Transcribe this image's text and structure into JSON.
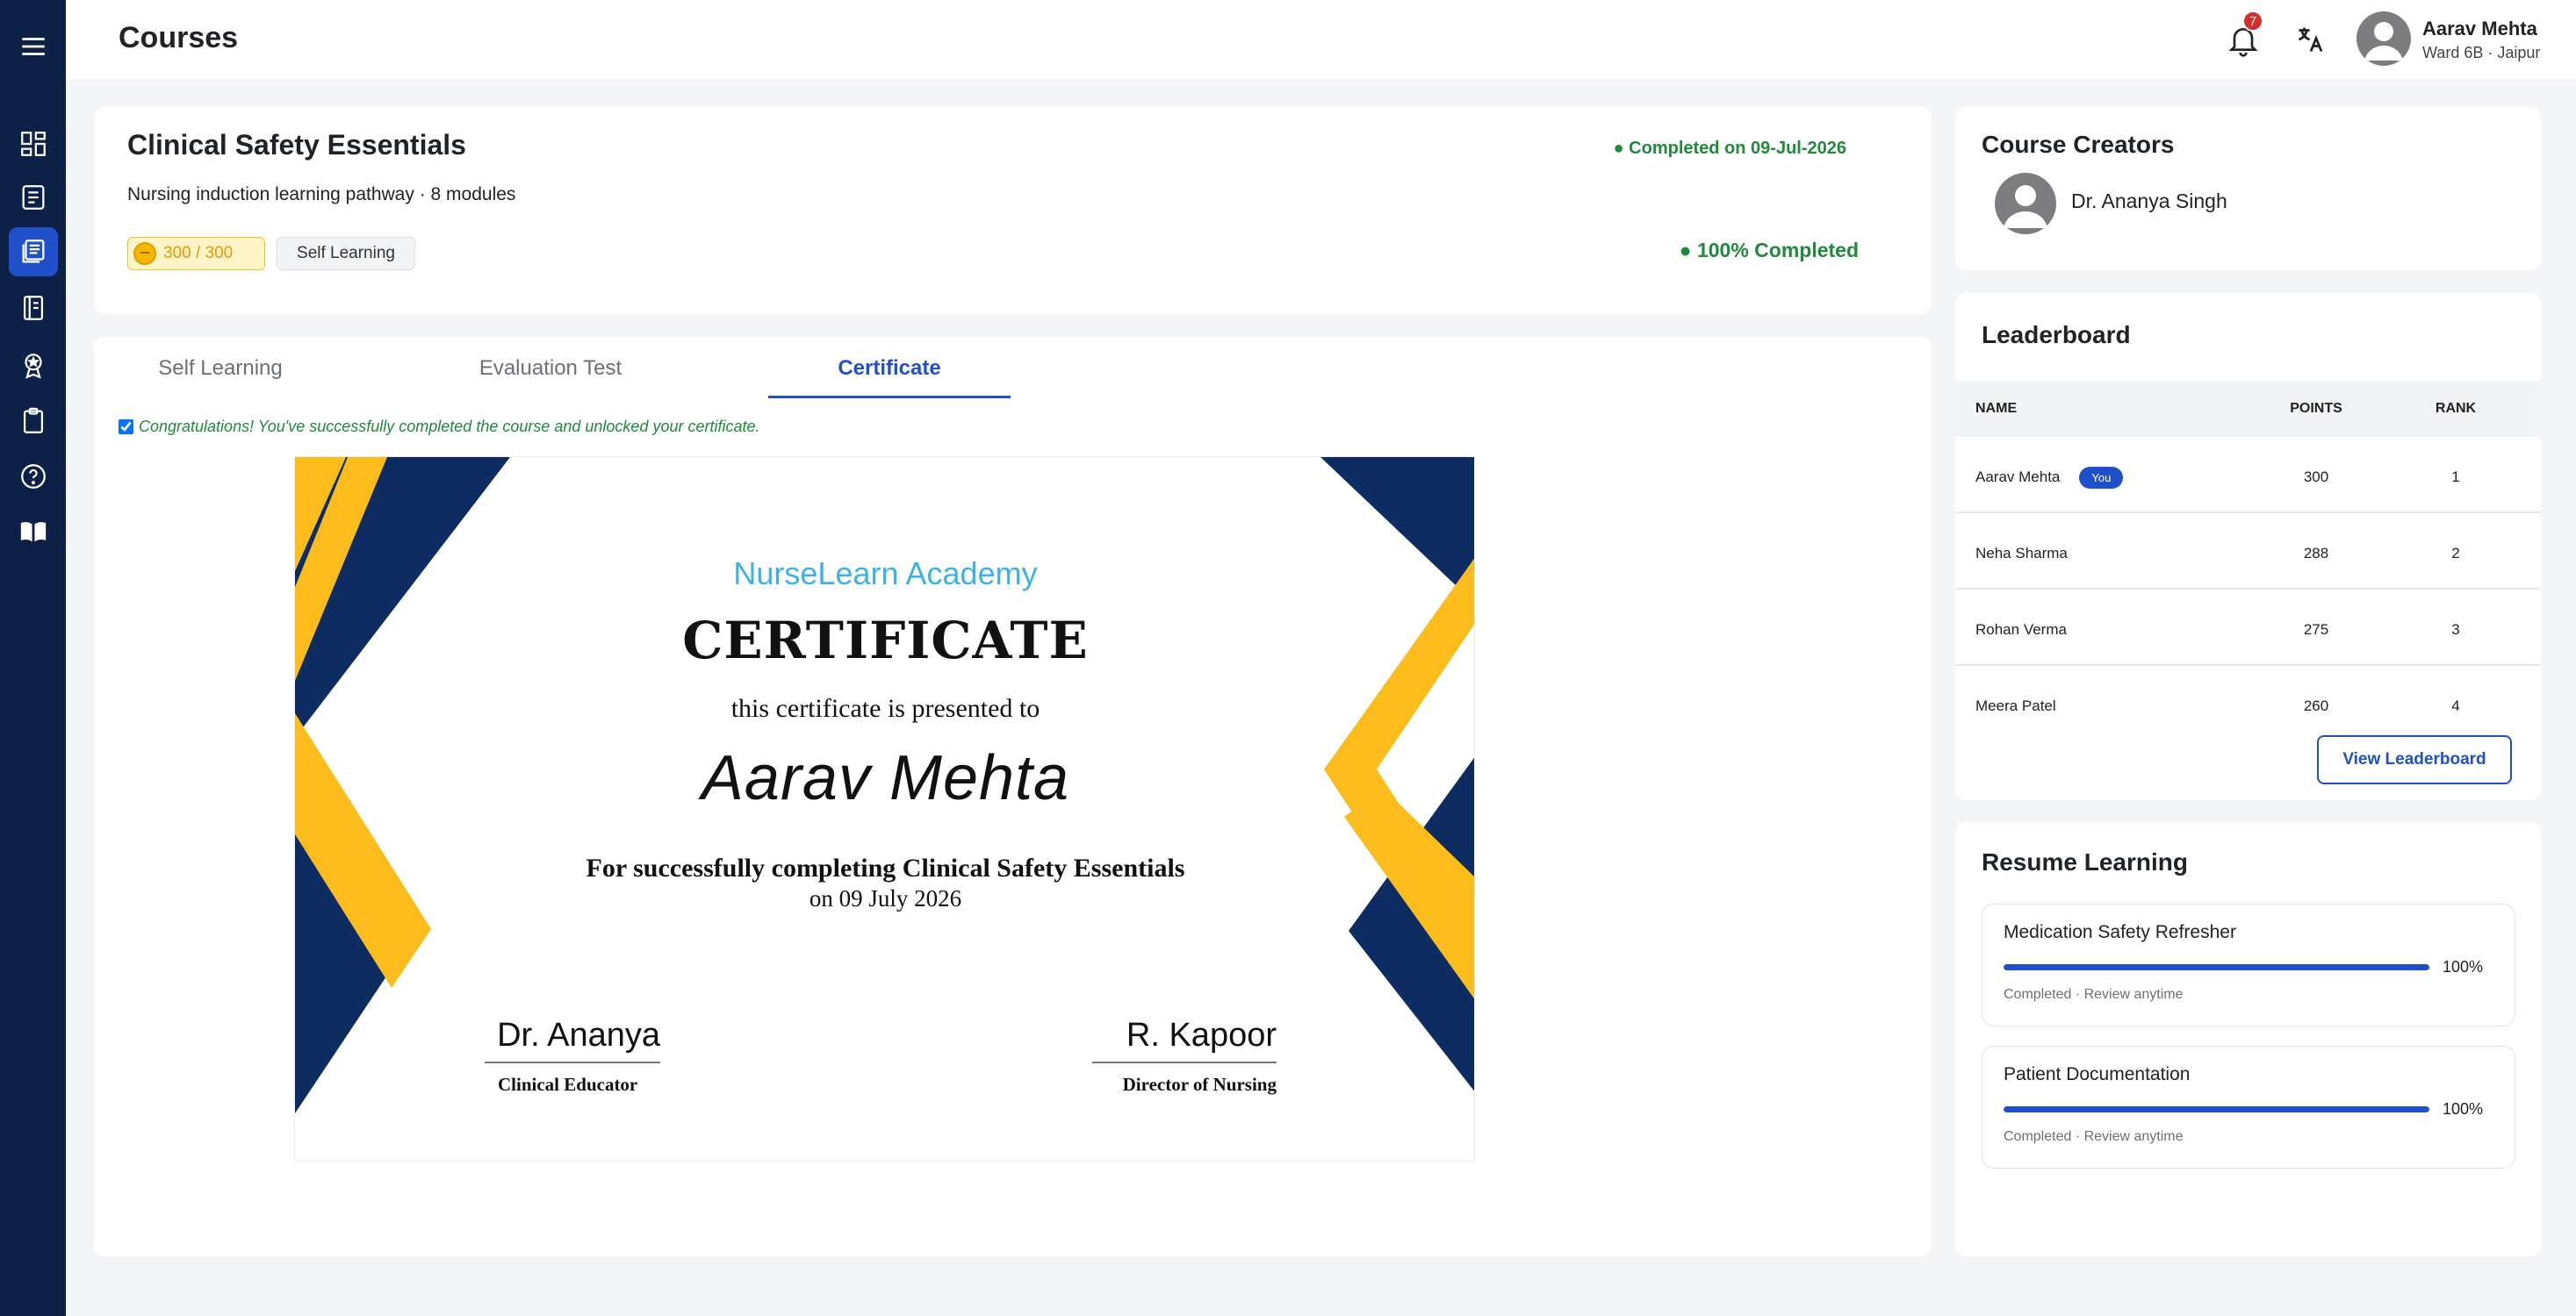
{
  "header": {
    "page_title": "Courses",
    "notification_count": "7",
    "user_name": "Aarav Mehta",
    "user_location": "Ward 6B · Jaipur"
  },
  "sidebar": {
    "items": [
      {
        "icon": "dashboard-icon"
      },
      {
        "icon": "notes-icon"
      },
      {
        "icon": "courses-icon",
        "active": true
      },
      {
        "icon": "journal-icon"
      },
      {
        "icon": "badge-icon"
      },
      {
        "icon": "clipboard-icon"
      },
      {
        "icon": "help-icon"
      },
      {
        "icon": "library-icon"
      }
    ]
  },
  "course": {
    "title": "Clinical Safety Essentials",
    "subtitle": "Nursing induction learning pathway · 8 modules",
    "points": "300 / 300",
    "type": "Self Learning",
    "completed_on": "● Completed on 09-Jul-2026",
    "progress_text": "● 100% Completed"
  },
  "tabs": [
    {
      "label": "Self Learning"
    },
    {
      "label": "Evaluation Test"
    },
    {
      "label": "Certificate",
      "active": true
    }
  ],
  "congrats": "Congratulations! You've successfully completed the course and unlocked your certificate.",
  "certificate": {
    "org": "NurseLearn Academy",
    "title": "CERTIFICATE",
    "presented_to": "this certificate is presented to",
    "recipient": "Aarav Mehta",
    "reason": "For successfully completing Clinical Safety Essentials",
    "date": "on 09 July 2026",
    "signatures": [
      {
        "name": "Dr. Ananya",
        "role": "Clinical Educator"
      },
      {
        "name": "R. Kapoor",
        "role": "Director of Nursing"
      }
    ],
    "colors": {
      "navy": "#0d2c61",
      "gold": "#fcbd1c"
    }
  },
  "creators": {
    "heading": "Course Creators",
    "items": [
      {
        "name": "Dr. Ananya Singh"
      }
    ]
  },
  "leaderboard": {
    "heading": "Leaderboard",
    "columns": [
      "NAME",
      "POINTS",
      "RANK"
    ],
    "you_label": "You",
    "rows": [
      {
        "name": "Aarav Mehta",
        "points": "300",
        "rank": "1",
        "is_you": true
      },
      {
        "name": "Neha Sharma",
        "points": "288",
        "rank": "2"
      },
      {
        "name": "Rohan Verma",
        "points": "275",
        "rank": "3"
      },
      {
        "name": "Meera Patel",
        "points": "260",
        "rank": "4"
      }
    ],
    "view_label": "View Leaderboard"
  },
  "resume": {
    "heading": "Resume Learning",
    "items": [
      {
        "title": "Medication Safety Refresher",
        "progress": 1.0,
        "pct": "100%",
        "status": "Completed · Review anytime"
      },
      {
        "title": "Patient Documentation",
        "progress": 1.0,
        "pct": "100%",
        "status": "Completed · Review anytime"
      }
    ]
  },
  "colors": {
    "primary": "#1f4fc9",
    "sidebar": "#0d2147",
    "success": "#1f8a3b"
  }
}
